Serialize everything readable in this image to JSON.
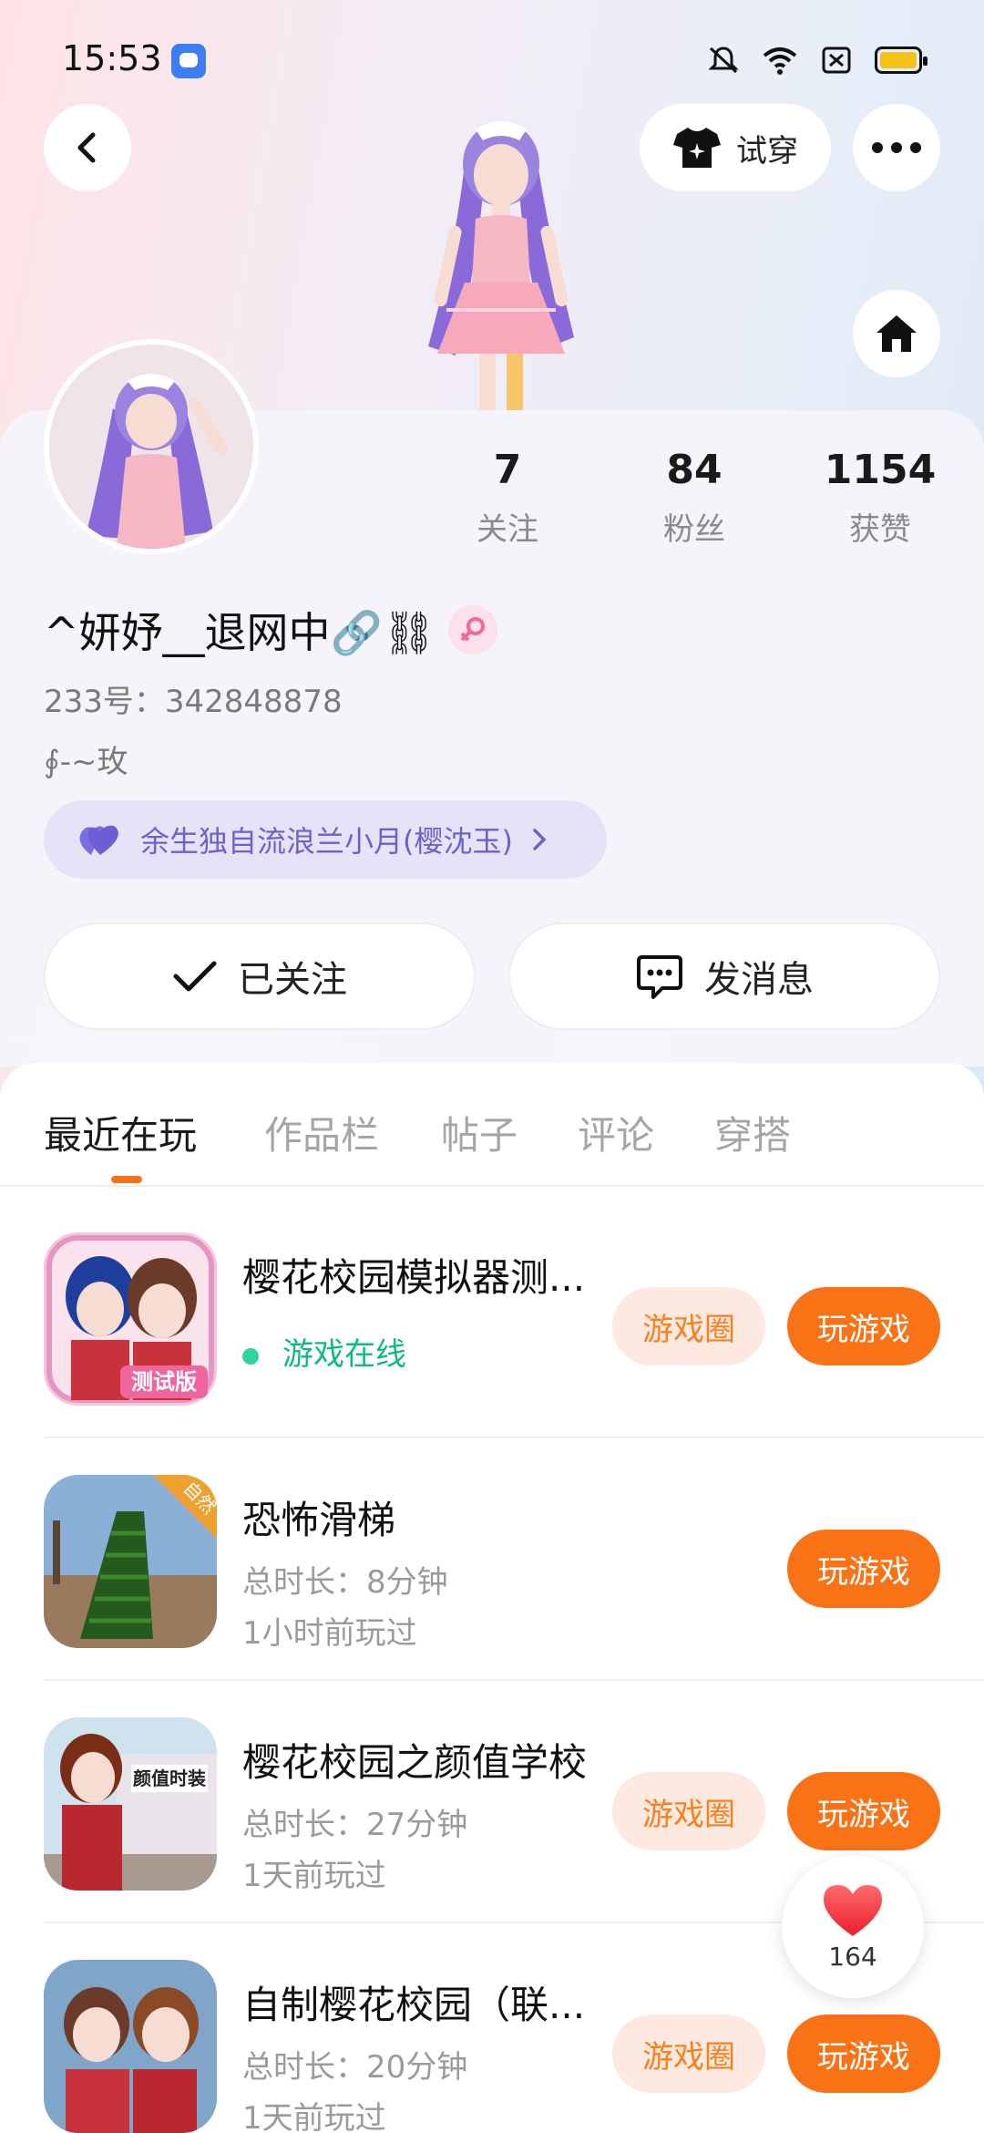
{
  "status_bar": {
    "time": "15:53"
  },
  "header": {
    "tryon_label": "试穿"
  },
  "profile": {
    "stats": [
      {
        "value": "7",
        "label": "关注"
      },
      {
        "value": "84",
        "label": "粉丝"
      },
      {
        "value": "1154",
        "label": "获赞"
      }
    ],
    "username": "^妍妤__退网中🔗⛓",
    "user_id": "233号：342848878",
    "signature": "∮-~玫",
    "relation": "余生独自流浪兰小月(樱沈玉)",
    "followed_label": "已关注",
    "message_label": "发消息"
  },
  "tabs": [
    "最近在玩",
    "作品栏",
    "帖子",
    "评论",
    "穿搭"
  ],
  "games": [
    {
      "name": "樱花校园模拟器测...",
      "meta1": "游戏在线",
      "meta2": "",
      "has_circle": true,
      "circle_label": "游戏圈",
      "play_label": "玩游戏"
    },
    {
      "name": "恐怖滑梯",
      "meta1": "总时长：8分钟",
      "meta2": "1小时前玩过",
      "has_circle": false,
      "circle_label": "",
      "play_label": "玩游戏"
    },
    {
      "name": "樱花校园之颜值学校",
      "meta1": "总时长：27分钟",
      "meta2": "1天前玩过",
      "has_circle": true,
      "circle_label": "游戏圈",
      "play_label": "玩游戏"
    },
    {
      "name": "自制樱花校园（联...",
      "meta1": "总时长：20分钟",
      "meta2": "1天前玩过",
      "has_circle": true,
      "circle_label": "游戏圈",
      "play_label": "玩游戏"
    }
  ],
  "like_fab": {
    "count": "164"
  },
  "colors": {
    "accent": "#f97316",
    "relation": "#6c62c9",
    "online": "#10b981"
  }
}
